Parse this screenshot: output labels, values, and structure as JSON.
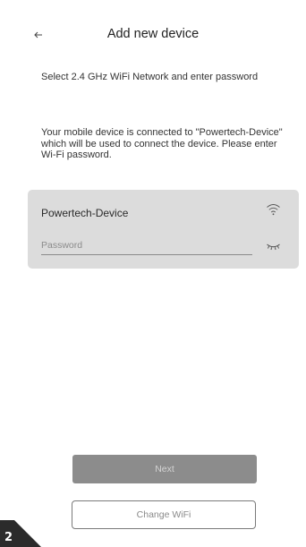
{
  "header": {
    "back_icon": "arrow-left-icon",
    "title": "Add new device"
  },
  "intro_text": "Select 2.4 GHz WiFi Network and enter password",
  "info_text": "Your mobile device is connected to \"Powertech-Device\" which will be used to connect the device. Please enter Wi-Fi password.",
  "network_card": {
    "network_name": "Powertech-Device",
    "wifi_icon": "wifi-icon",
    "password_value": "",
    "password_placeholder": "Password",
    "visibility_icon": "eye-closed-icon"
  },
  "buttons": {
    "next_label": "Next",
    "change_wifi_label": "Change WiFi"
  },
  "page_badge": "2",
  "colors": {
    "card_background": "#dcdcdc",
    "next_button": "#8c8c8c",
    "badge": "#2b2b2b"
  }
}
